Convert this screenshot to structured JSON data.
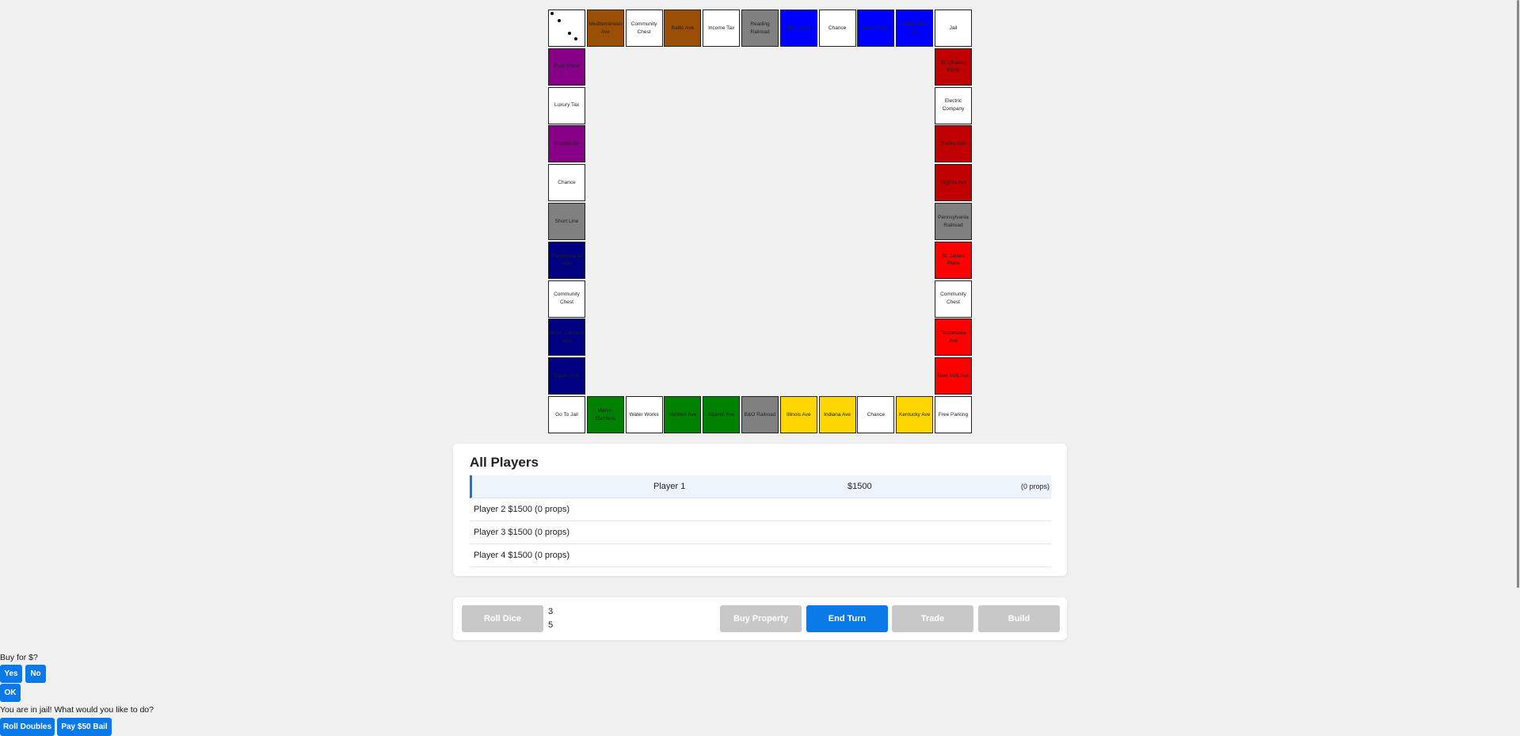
{
  "colors": {
    "brown": "#9a4f05",
    "light_blue": "#0000ff",
    "pink": "#880088",
    "orange": "#c00000",
    "red": "#ff0000",
    "yellow": "#ffd700",
    "green": "#018101",
    "dark_blue": "#000080",
    "railroad": "#808080",
    "white": "#ffffff",
    "accent": "#0b79e8"
  },
  "board": {
    "top_row": [
      {
        "name": "",
        "color": "white",
        "tokens": true
      },
      {
        "name": "Mediterranean Ave",
        "color": "brown"
      },
      {
        "name": "Community Chest",
        "color": "white"
      },
      {
        "name": "Baltic Ave",
        "color": "brown"
      },
      {
        "name": "Income Tax",
        "color": "white"
      },
      {
        "name": "Reading Railroad",
        "color": "railroad"
      },
      {
        "name": "Oriental Ave",
        "color": "light_blue"
      },
      {
        "name": "Chance",
        "color": "white"
      },
      {
        "name": "Vermont Ave",
        "color": "light_blue"
      },
      {
        "name": "Connecticut Ave",
        "color": "light_blue"
      },
      {
        "name": "Jail",
        "color": "white"
      }
    ],
    "left_col": [
      {
        "name": "Park Place",
        "color": "pink"
      },
      {
        "name": "Luxury Tax",
        "color": "white"
      },
      {
        "name": "Boardwalk",
        "color": "pink"
      },
      {
        "name": "Chance",
        "color": "white"
      },
      {
        "name": "Short Line",
        "color": "railroad"
      },
      {
        "name": "Pennsylvania Ave",
        "color": "dark_blue"
      },
      {
        "name": "Community Chest",
        "color": "white"
      },
      {
        "name": "North Carolina Ave",
        "color": "dark_blue"
      },
      {
        "name": "Pacific Ave",
        "color": "dark_blue"
      }
    ],
    "right_col": [
      {
        "name": "St. Charles Place",
        "color": "orange"
      },
      {
        "name": "Electric Company",
        "color": "white"
      },
      {
        "name": "States Ave",
        "color": "orange"
      },
      {
        "name": "Virginia Ave",
        "color": "orange"
      },
      {
        "name": "Pennsylvania Railroad",
        "color": "railroad"
      },
      {
        "name": "St. James Place",
        "color": "red"
      },
      {
        "name": "Community Chest",
        "color": "white"
      },
      {
        "name": "Tennessee Ave",
        "color": "red"
      },
      {
        "name": "New York Ave",
        "color": "red"
      }
    ],
    "bottom_row": [
      {
        "name": "Go To Jail",
        "color": "white"
      },
      {
        "name": "Marvin Gardens",
        "color": "green"
      },
      {
        "name": "Water Works",
        "color": "white"
      },
      {
        "name": "Ventnor Ave",
        "color": "green"
      },
      {
        "name": "Atlantic Ave",
        "color": "green"
      },
      {
        "name": "B&O Railroad",
        "color": "railroad"
      },
      {
        "name": "Illinois Ave",
        "color": "yellow"
      },
      {
        "name": "Indiana Ave",
        "color": "yellow"
      },
      {
        "name": "Chance",
        "color": "white"
      },
      {
        "name": "Kentucky Ave",
        "color": "yellow"
      },
      {
        "name": "Free Parking",
        "color": "white"
      }
    ]
  },
  "players_panel": {
    "title": "All Players",
    "active": {
      "name": "Player 1",
      "money": "$1500",
      "props": "(0 props)"
    },
    "others": [
      "Player 2 $1500 (0 props)",
      "Player 3 $1500 (0 props)",
      "Player 4 $1500 (0 props)"
    ]
  },
  "controls": {
    "roll_dice": "Roll Dice",
    "die1": "3",
    "die2": "5",
    "buy_property": "Buy Property",
    "end_turn": "End Turn",
    "trade": "Trade",
    "build": "Build"
  },
  "prompts": {
    "buy_question": "Buy for $?",
    "yes": "Yes",
    "no": "No",
    "ok": "OK",
    "jail_question": "You are in jail! What would you like to do?",
    "roll_doubles": "Roll Doubles",
    "pay_bail": "Pay $50 Bail"
  }
}
